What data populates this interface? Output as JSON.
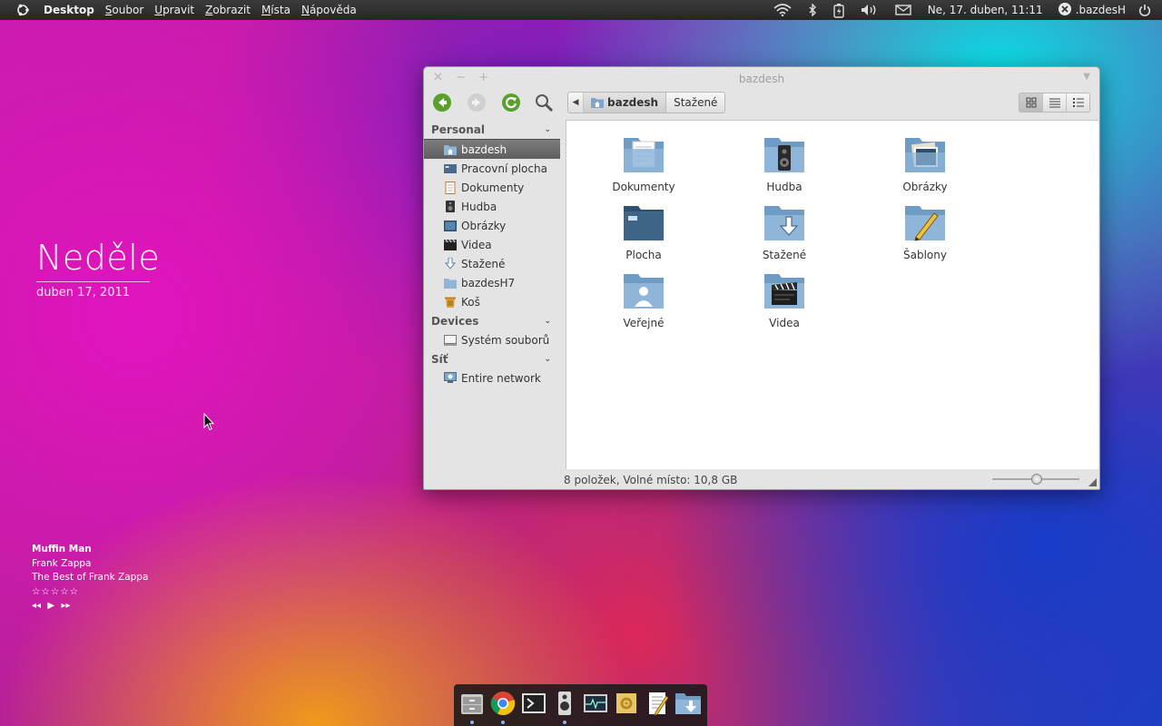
{
  "top_panel": {
    "app_name": "Desktop",
    "menus": [
      {
        "underline": "S",
        "rest": "oubor"
      },
      {
        "underline": "U",
        "rest": "pravit"
      },
      {
        "underline": "Z",
        "rest": "obrazit"
      },
      {
        "underline": "M",
        "rest": "ísta"
      },
      {
        "underline": "N",
        "rest": "ápověda"
      }
    ],
    "clock": "Ne, 17. duben, 11:11",
    "username": ".bazdesH"
  },
  "day_widget": {
    "day": "Neděle",
    "date": "duben 17, 2011"
  },
  "music": {
    "title": "Muffin Man",
    "artist": "Frank Zappa",
    "album": "The Best of Frank Zappa",
    "rating_stars": "☆☆☆☆☆",
    "prev": "◂◂",
    "play": "▶",
    "next": "▸▸"
  },
  "window": {
    "title": "bazdesh",
    "path": [
      "bazdesh",
      "Stažené"
    ],
    "sidebar": [
      {
        "heading": "Personal",
        "items": [
          {
            "label": "bazdesh",
            "icon": "home-folder-icon",
            "selected": true
          },
          {
            "label": "Pracovní plocha",
            "icon": "desktop-icon"
          },
          {
            "label": "Dokumenty",
            "icon": "documents-icon"
          },
          {
            "label": "Hudba",
            "icon": "music-icon"
          },
          {
            "label": "Obrázky",
            "icon": "pictures-icon"
          },
          {
            "label": "Videa",
            "icon": "video-icon"
          },
          {
            "label": "Stažené",
            "icon": "downloads-icon"
          },
          {
            "label": "bazdesH7",
            "icon": "folder-icon"
          },
          {
            "label": "Koš",
            "icon": "trash-icon"
          }
        ]
      },
      {
        "heading": "Devices",
        "items": [
          {
            "label": "Systém souborů",
            "icon": "drive-icon"
          }
        ]
      },
      {
        "heading": "Síť",
        "items": [
          {
            "label": "Entire network",
            "icon": "network-icon"
          }
        ]
      }
    ],
    "files": [
      {
        "label": "Dokumenty",
        "icon": "documents-folder-icon"
      },
      {
        "label": "Hudba",
        "icon": "music-folder-icon"
      },
      {
        "label": "Obrázky",
        "icon": "pictures-folder-icon"
      },
      {
        "label": "Plocha",
        "icon": "desktop-folder-icon"
      },
      {
        "label": "Stažené",
        "icon": "downloads-folder-icon"
      },
      {
        "label": "Šablony",
        "icon": "templates-folder-icon"
      },
      {
        "label": "Veřejné",
        "icon": "public-folder-icon"
      },
      {
        "label": "Videa",
        "icon": "videos-folder-icon"
      }
    ],
    "status": "8 položek, Volné místo: 10,8 GB",
    "zoom_level": 0.5
  },
  "dock": [
    "file-cabinet-icon",
    "chrome-icon",
    "terminal-icon",
    "speaker-icon",
    "system-monitor-icon",
    "settings-icon",
    "text-editor-icon",
    "downloads-folder-icon"
  ],
  "colors": {
    "panel": "#2b2b2b",
    "selection": "#6c6c6c",
    "accent_green": "#5aa02c",
    "folder_blue": "#7da6c8"
  }
}
